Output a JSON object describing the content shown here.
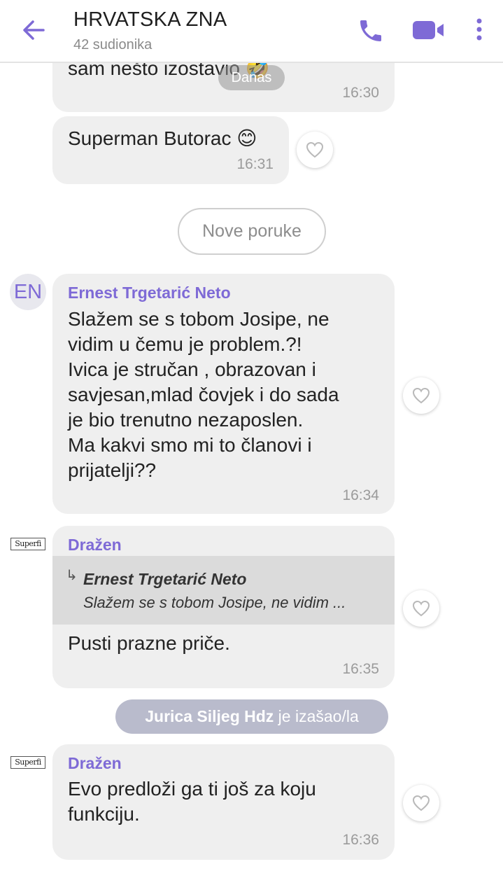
{
  "header": {
    "title": "HRVATSKA ZNA",
    "subtitle": "42 sudionika"
  },
  "date_chip": "Danas",
  "messages": [
    {
      "text": "sam nešto izostavio 🤣",
      "time": "16:30"
    },
    {
      "text": "Superman Butorac 😊",
      "time": "16:31"
    },
    {
      "sender": "Ernest Trgetarić Neto",
      "avatar_initials": "EN",
      "text": "Slažem se s tobom Josipe, ne\nvidim u čemu je problem.?!\nIvica je stručan , obrazovan i\nsavjesan,mlad čovjek i do sada\nje bio trenutno nezaposlen.\nMa kakvi smo mi to članovi i\nprijatelji??",
      "time": "16:34"
    },
    {
      "sender": "Dražen",
      "avatar_label": "Superfi",
      "quote": {
        "name": "Ernest Trgetarić Neto",
        "text": "Slažem se s tobom Josipe, ne vidim ..."
      },
      "text": "Pusti prazne priče.",
      "time": "16:35"
    },
    {
      "sender": "Dražen",
      "avatar_label": "Superfi",
      "text": "Evo predloži ga ti još za koju\nfunkciju.",
      "time": "16:36"
    }
  ],
  "new_messages_label": "Nove poruke",
  "system": {
    "name": "Jurica Siljeg Hdz",
    "action": " je izašao/la"
  },
  "icons": {
    "back": "arrow-left-icon",
    "call": "phone-icon",
    "video": "video-camera-icon",
    "more": "more-vertical-icon",
    "like": "heart-icon"
  },
  "colors": {
    "accent": "#7e6ad6",
    "bubble": "#efefef",
    "system_pill": "#b9bbcc"
  }
}
